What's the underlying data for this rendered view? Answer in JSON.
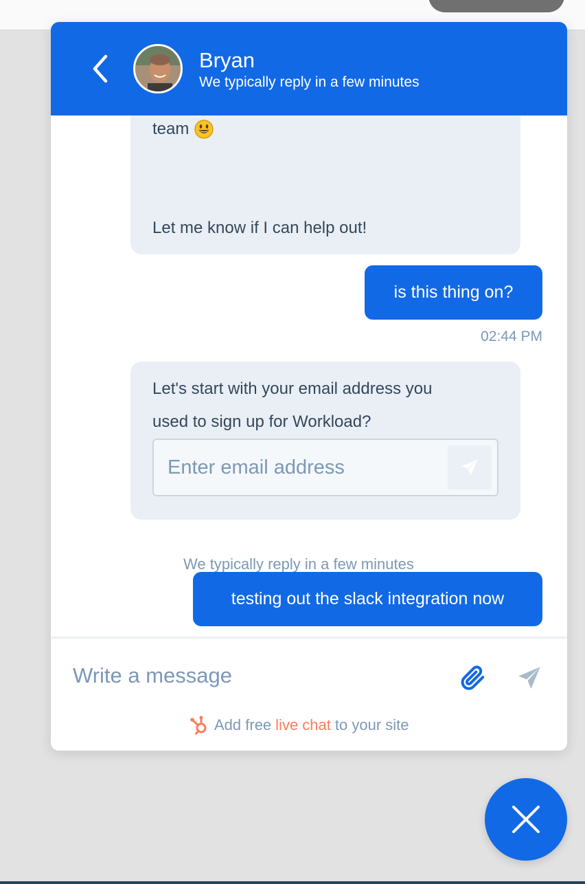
{
  "header": {
    "agent_name": "Bryan",
    "agent_status": "We typically reply in a few minutes",
    "background_color": "#1169e6"
  },
  "messages": {
    "welcome_tail_line1": "team",
    "welcome_tail_emoji": "😃",
    "welcome_tail_line2": "Let me know if I can help out!",
    "user_message_1": "is this thing on?",
    "user_message_1_time": "02:44 PM",
    "email_prompt_line1": "Let's start with your email address you",
    "email_prompt_line2": "used to sign up for Workload?",
    "email_placeholder": "Enter email address",
    "reply_note": "We typically reply in a few minutes",
    "user_message_2": "testing out the slack integration now"
  },
  "composer": {
    "placeholder": "Write a message"
  },
  "branding": {
    "prefix": "Add free",
    "accent": "live chat",
    "suffix": "to your site",
    "accent_color": "#ff7a59"
  },
  "icons": {
    "back": "chevron-left-icon",
    "send": "paper-plane-icon",
    "attach": "paperclip-icon",
    "hubspot": "hubspot-sprocket-icon",
    "close": "close-icon"
  }
}
